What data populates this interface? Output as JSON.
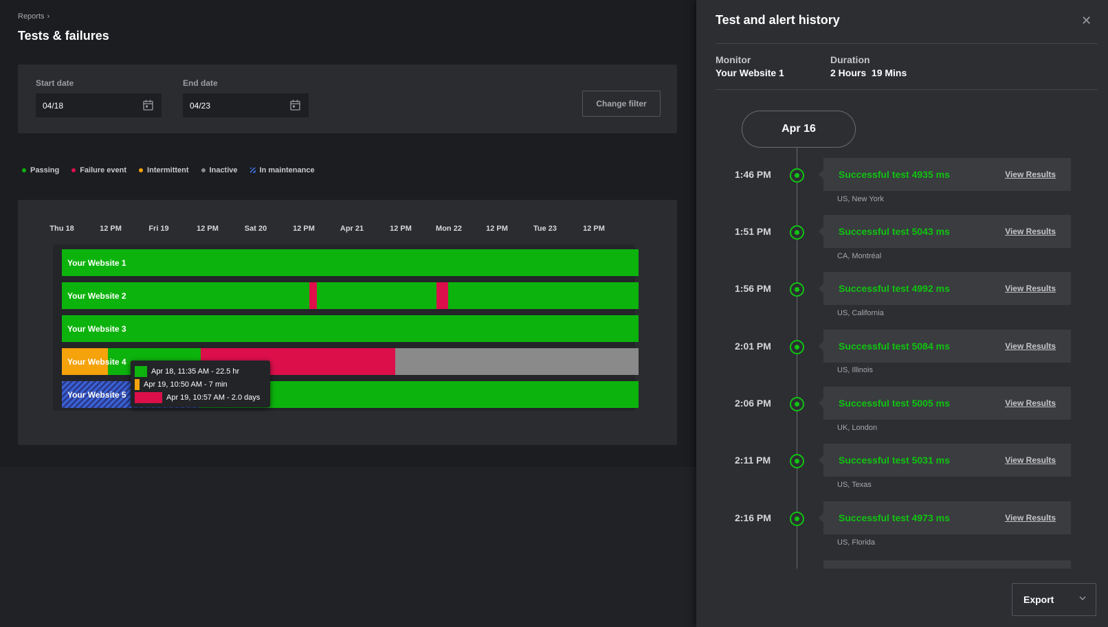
{
  "breadcrumb": {
    "parent": "Reports"
  },
  "page_title": "Tests & failures",
  "filter": {
    "start_label": "Start date",
    "start_value": "04/18",
    "end_label": "End date",
    "end_value": "04/23",
    "change_button": "Change filter"
  },
  "legend": [
    {
      "label": "Passing",
      "color": "#0db30d"
    },
    {
      "label": "Failure event",
      "color": "#dc0f4b"
    },
    {
      "label": "Intermittent",
      "color": "#f5a20b"
    },
    {
      "label": "Inactive",
      "color": "#8a8a8a"
    },
    {
      "label": "In maintenance",
      "color": "#3e6bd6"
    }
  ],
  "timeline_axis": [
    "Thu 18",
    "12 PM",
    "Fri 19",
    "12 PM",
    "Sat 20",
    "12 PM",
    "Apr 21",
    "12 PM",
    "Mon 22",
    "12 PM",
    "Tue 23",
    "12 PM"
  ],
  "websites": [
    {
      "name": "Your Website 1"
    },
    {
      "name": "Your Website 2"
    },
    {
      "name": "Your Website 3"
    },
    {
      "name": "Your Website 4"
    },
    {
      "name": "Your Website 5"
    }
  ],
  "tooltip": [
    {
      "text": "Apr 18, 11:35 AM - 22.5 hr",
      "color": "#0db30d"
    },
    {
      "text": "Apr 19, 10:50 AM - 7 min",
      "color": "#f5a20b"
    },
    {
      "text": "Apr 19, 10:57 AM - 2.0 days",
      "color": "#dc0f4b"
    }
  ],
  "side_panel": {
    "title": "Test and alert history",
    "close_icon": "close-icon",
    "monitor_label": "Monitor",
    "monitor_value": "Your Website 1",
    "duration_label": "Duration",
    "duration_value": "2 Hours  19 Mins",
    "date_pill": "Apr 16",
    "view_link": "View Results",
    "events": [
      {
        "time": "1:46 PM",
        "status": "Successful test 4935 ms",
        "location": "US, New York"
      },
      {
        "time": "1:51 PM",
        "status": "Successful test 5043 ms",
        "location": "CA, Montréal"
      },
      {
        "time": "1:56 PM",
        "status": "Successful test 4992 ms",
        "location": "US, California"
      },
      {
        "time": "2:01 PM",
        "status": "Successful test 5084 ms",
        "location": "US, Illinois"
      },
      {
        "time": "2:06 PM",
        "status": "Successful test 5005 ms",
        "location": "UK, London"
      },
      {
        "time": "2:11 PM",
        "status": "Successful test 5031 ms",
        "location": "US, Texas"
      },
      {
        "time": "2:16 PM",
        "status": "Successful test 4973 ms",
        "location": "US, Florida"
      }
    ],
    "export_button": "Export"
  }
}
